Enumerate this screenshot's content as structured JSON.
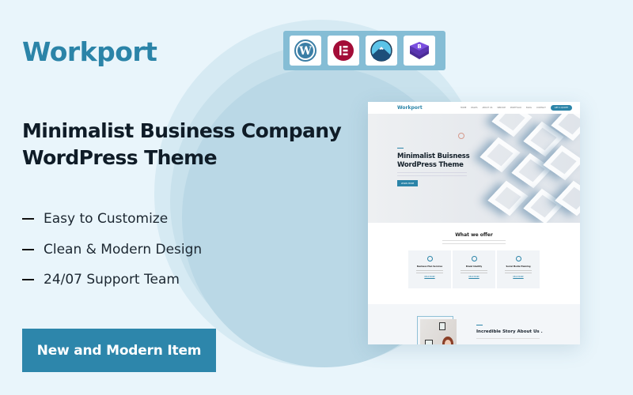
{
  "brand": {
    "name": "Workport",
    "color": "#2b84a8"
  },
  "headline": {
    "line1": "Minimalist Business Company",
    "line2": "WordPress Theme"
  },
  "features": [
    "Easy to Customize",
    "Clean & Modern Design",
    "24/07 Support Team"
  ],
  "cta": {
    "label": "New and Modern Item",
    "color": "#2d86ab"
  },
  "badges": [
    {
      "name": "wordpress-icon",
      "color": "#3b7ea5"
    },
    {
      "name": "elementor-icon",
      "color": "#a30d38"
    },
    {
      "name": "mountain-icon",
      "color": "#1d4f7a"
    },
    {
      "name": "bootstrap-icon",
      "color": "#6a3fc2"
    }
  ],
  "mockup": {
    "nav": {
      "logo": "Workport",
      "links": [
        "HOME",
        "PAGES",
        "ABOUT US",
        "SERVICE",
        "PORTFOLIO",
        "BLOG",
        "CONTACT"
      ],
      "quote_button": "GET A QUOTE"
    },
    "hero": {
      "title_line1": "Minimalist Buisness",
      "title_line2": "WordPress Theme",
      "button": "LEARN MORE"
    },
    "offer": {
      "title": "What we offer",
      "cards": [
        {
          "title": "Business Plan Services",
          "link": "READ MORE"
        },
        {
          "title": "Brand Identity",
          "link": "READ MORE"
        },
        {
          "title": "Social Media Planning",
          "link": "READ MORE"
        }
      ]
    },
    "story": {
      "title": "Incredible Story About Us ."
    }
  }
}
